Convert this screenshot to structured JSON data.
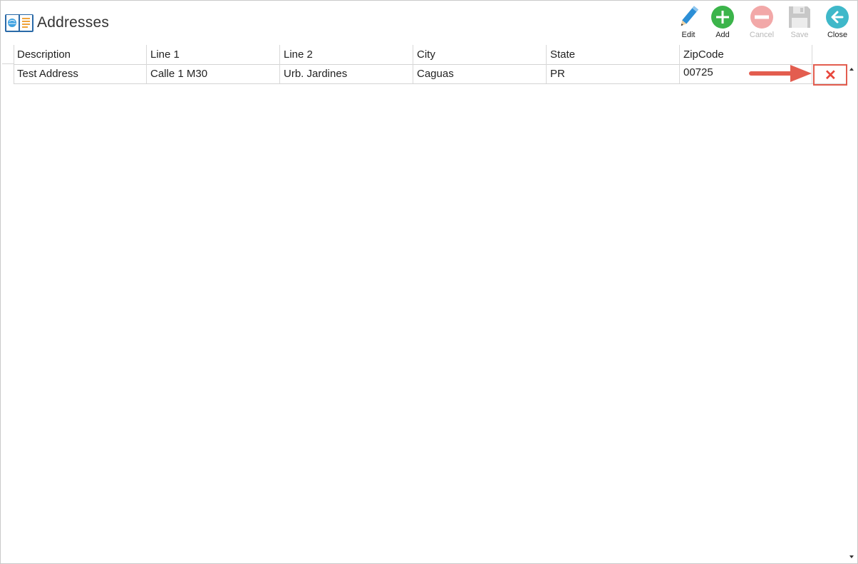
{
  "window": {
    "title": "Addresses",
    "title_icon": "address-book-icon"
  },
  "toolbar": {
    "edit": {
      "label": "Edit",
      "icon": "pencil-icon",
      "enabled": true
    },
    "add": {
      "label": "Add",
      "icon": "plus-circle-icon",
      "enabled": true
    },
    "cancel": {
      "label": "Cancel",
      "icon": "minus-circle-icon",
      "enabled": false
    },
    "save": {
      "label": "Save",
      "icon": "floppy-disk-icon",
      "enabled": false
    },
    "close": {
      "label": "Close",
      "icon": "back-arrow-icon",
      "enabled": true
    }
  },
  "grid": {
    "columns": [
      "Description",
      "Line 1",
      "Line 2",
      "City",
      "State",
      "ZipCode"
    ],
    "rows": [
      {
        "description": "Test Address",
        "line1": "Calle 1 M30",
        "line2": "Urb. Jardines",
        "city": "Caguas",
        "state": "PR",
        "zipcode": "00725",
        "delete_icon": "delete-x-icon"
      }
    ]
  },
  "colors": {
    "add_green": "#3bb44a",
    "cancel_red_disabled": "#f2a8a8",
    "close_teal": "#3fb8c9",
    "edit_blue": "#2c8fd6",
    "delete_red": "#e8473c",
    "annotation_red": "#e35d4f"
  }
}
